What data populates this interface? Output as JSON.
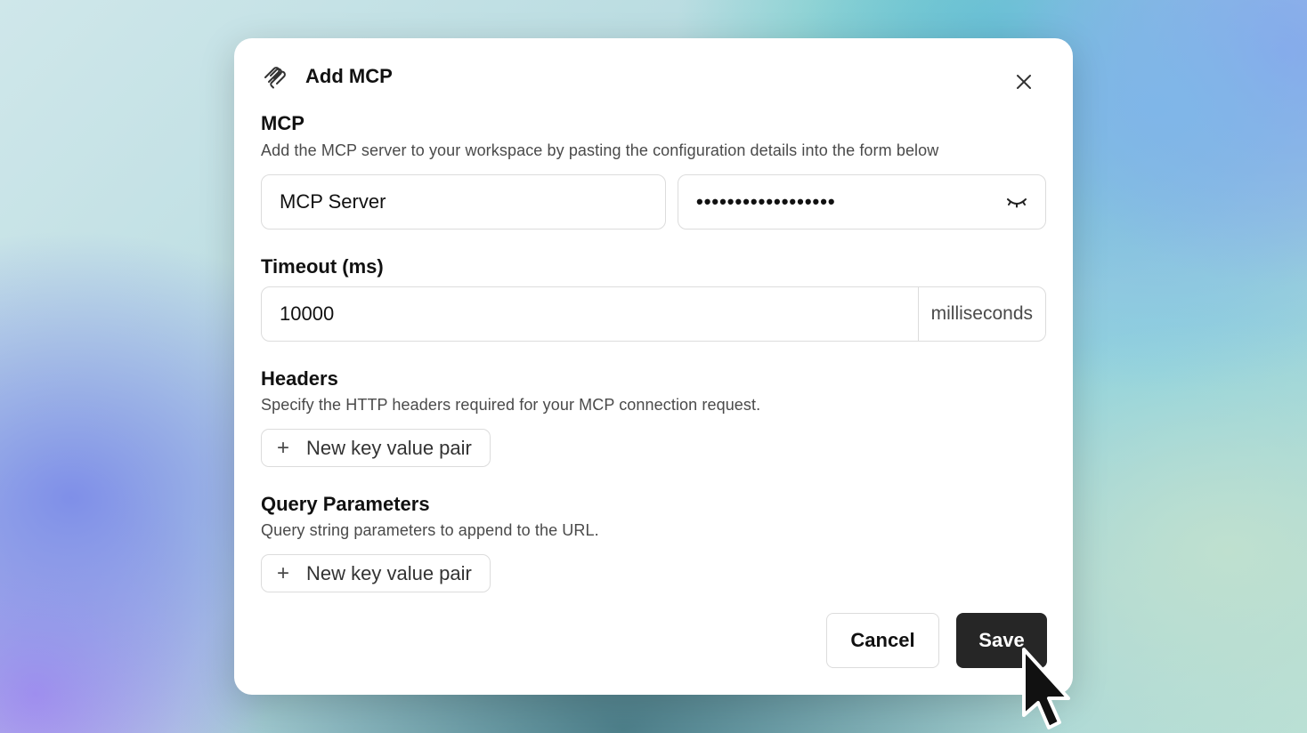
{
  "dialog": {
    "title": "Add MCP",
    "icon": "mcp-icon",
    "close_icon": "close-icon"
  },
  "mcp_section": {
    "title": "MCP",
    "description": "Add the MCP server to your workspace by pasting the configuration details into the form below",
    "name_value": "MCP Server",
    "secret_value": "••••••••••••••••••",
    "secret_toggle_icon": "eye-closed-icon"
  },
  "timeout_section": {
    "title": "Timeout (ms)",
    "value": "10000",
    "unit": "milliseconds"
  },
  "headers_section": {
    "title": "Headers",
    "description": "Specify the HTTP headers required for your MCP connection request.",
    "add_label": "New key value pair"
  },
  "query_section": {
    "title": "Query Parameters",
    "description": "Query string parameters to append to the URL.",
    "add_label": "New key value pair"
  },
  "footer": {
    "cancel_label": "Cancel",
    "save_label": "Save"
  },
  "colors": {
    "primary_button": "#262626",
    "border": "#dcdcdc",
    "text": "#111111",
    "muted_text": "#4a4a4a"
  }
}
